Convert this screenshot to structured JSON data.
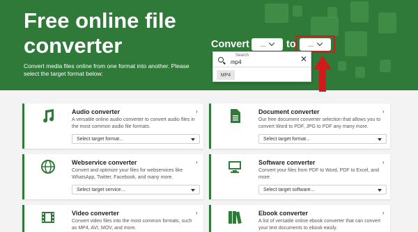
{
  "hero": {
    "title": "Free online file converter",
    "subtitle": "Convert media files online from one format into another. Please select the target format below:"
  },
  "converter": {
    "convert_label": "Convert",
    "from_value": "...",
    "to_label": "to",
    "to_value": "..."
  },
  "dropdown": {
    "search_label": "Search",
    "search_value": "mp4",
    "close": "✕",
    "option": "MP4"
  },
  "cards": [
    {
      "title": "Audio converter",
      "desc": "A versatile online audio converter to convert audio files in the most common audio file formats.",
      "select": "Select target format...",
      "icon": "music-note-icon"
    },
    {
      "title": "Document converter",
      "desc": "Our free document converter selection that allows you to convert Word to PDF, JPG to PDF any many more.",
      "select": "Select target format...",
      "icon": "document-icon"
    },
    {
      "title": "Webservice converter",
      "desc": "Convert and optimize your files for webservices like WhatsApp, Twitter, Facebook, and many more.",
      "select": "Select target service...",
      "icon": "globe-icon"
    },
    {
      "title": "Software converter",
      "desc": "Convert your files from PDF to Word, PDF to Excel, and more.",
      "select": "Select target software...",
      "icon": "monitor-icon"
    },
    {
      "title": "Video converter",
      "desc": "Convert video files into the most common formats, such as MP4, AVI, MOV, and more.",
      "select": "",
      "icon": "film-icon"
    },
    {
      "title": "Ebook converter",
      "desc": "A list of versatile online ebook converter that can convert your text documents to ebook easily.",
      "select": "",
      "icon": "books-icon"
    }
  ],
  "colors": {
    "brand": "#2f7a39",
    "highlight": "#d31a1a"
  }
}
